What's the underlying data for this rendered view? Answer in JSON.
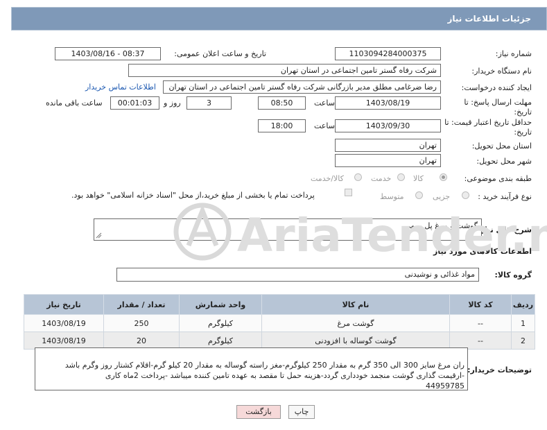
{
  "header": {
    "title": "جزئیات اطلاعات نیاز"
  },
  "fields": {
    "need_number_label": "شماره نیاز:",
    "need_number": "1103094284000375",
    "announce_label": "تاریخ و ساعت اعلان عمومی:",
    "announce_value": "1403/08/16 - 08:37",
    "buyer_org_label": "نام دستگاه خریدار:",
    "buyer_org": "شرکت رفاه گستر تامین اجتماعی در استان تهران",
    "requester_label": "ایجاد کننده درخواست:",
    "requester": "رضا ضرغامی مطلق مدیر بازرگانی شرکت رفاه گستر تامین اجتماعی در استان تهران",
    "contact_link": "اطلاعات تماس خریدار",
    "deadline_label_1": "مهلت ارسال پاسخ: تا",
    "deadline_label_2": "تاریخ:",
    "deadline_date": "1403/08/19",
    "time_label": "ساعت",
    "deadline_time": "08:50",
    "days_value": "3",
    "days_label": "روز و",
    "remaining_value": "00:01:03",
    "remaining_label": "ساعت باقی مانده",
    "validity_label_1": "حداقل تاریخ اعتبار قیمت: تا",
    "validity_label_2": "تاریخ:",
    "validity_date": "1403/09/30",
    "validity_time_label": "ساعت",
    "validity_time": "18:00",
    "province_label": "استان محل تحویل:",
    "province": "تهران",
    "city_label": "شهر محل تحویل:",
    "city": "تهران",
    "category_label": "طبقه بندی موضوعی:",
    "category_options": [
      "کالا",
      "خدمت",
      "کالا/خدمت"
    ],
    "category_selected": "کالا",
    "process_label": "نوع فرآیند خرید :",
    "process_options": [
      "جزیی",
      "متوسط"
    ],
    "process_note": "پرداخت تمام یا بخشی از مبلغ خرید،از محل \"اسناد خزانه اسلامی\" خواهد بود."
  },
  "summary": {
    "label": "شرح کلی نیاز:",
    "value": "گوشت و مرغ پل رومی"
  },
  "items_section": {
    "title": "اطلاعات کالاهای مورد نیاز",
    "group_label": "گروه کالا:",
    "group_value": "مواد غذائی و نوشیدنی"
  },
  "table": {
    "columns": [
      "ردیف",
      "کد کالا",
      "نام کالا",
      "واحد شمارش",
      "تعداد / مقدار",
      "تاریخ نیاز"
    ],
    "rows": [
      [
        "1",
        "--",
        "گوشت مرغ",
        "کیلوگرم",
        "250",
        "1403/08/19"
      ],
      [
        "2",
        "--",
        "گوشت گوساله با افزودنی",
        "کیلوگرم",
        "20",
        "1403/08/19"
      ]
    ]
  },
  "buyer_notes": {
    "label": "توضیحات خریدار:",
    "text": "ران مرغ سایز 300 الی 350 گرم به مقدار 250 کیلوگرم-مغز راسته گوساله  به مقدار 20 کیلو گرم-اقلام کشتار روز وگرم باشد\n-ارقیمت گذاری گوشت منجمد خودداری گردد-هزینه حمل تا مقصد به عهده تامین کننده میباشد -پرداخت 2ماه کاری\n44959785"
  },
  "buttons": {
    "print": "چاپ",
    "back": "بازگشت"
  },
  "watermark": {
    "text": "AriaTender.neT"
  },
  "colors": {
    "header_bg": "#7f99b8",
    "table_header_bg": "#b7c5d6",
    "link": "#1a57b0",
    "back_button_bg": "#f6d9d9"
  }
}
